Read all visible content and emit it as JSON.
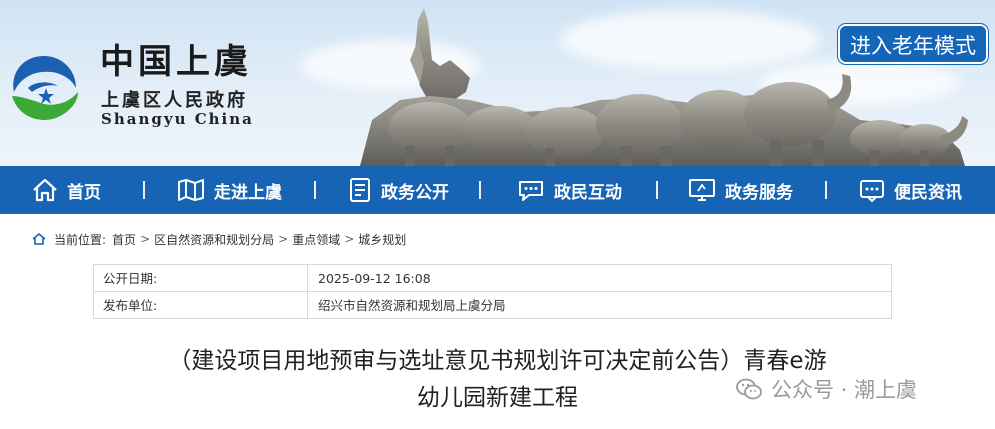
{
  "header": {
    "logo_title": "中国上虞",
    "logo_subtitle": "上虞区人民政府",
    "logo_english": "Shangyu  China",
    "elder_mode_label": "进入老年模式"
  },
  "nav": {
    "items": [
      {
        "label": "首页",
        "icon": "home-icon"
      },
      {
        "label": "走进上虞",
        "icon": "map-icon"
      },
      {
        "label": "政务公开",
        "icon": "document-icon"
      },
      {
        "label": "政民互动",
        "icon": "chat-icon"
      },
      {
        "label": "政务服务",
        "icon": "monitor-icon"
      },
      {
        "label": "便民资讯",
        "icon": "info-message-icon"
      }
    ]
  },
  "breadcrumb": {
    "prefix": "当前位置:",
    "items": [
      "首页",
      "区自然资源和规划分局",
      "重点领域",
      "城乡规划"
    ],
    "separator": ">"
  },
  "info": {
    "rows": [
      {
        "key": "公开日期:",
        "value": "2025-09-12 16:08"
      },
      {
        "key": "发布单位:",
        "value": "绍兴市自然资源和规划局上虞分局"
      }
    ]
  },
  "article": {
    "title_line1": "（建设项目用地预审与选址意见书规划许可决定前公告）青春e游",
    "title_line2": "幼儿园新建工程"
  },
  "watermark": {
    "text": "公众号 · 潮上虞"
  },
  "colors": {
    "nav_bg": "#1764b5",
    "elder_btn_bg": "#1565b8",
    "logo_blue": "#1d5fb0",
    "logo_green": "#3aa935"
  }
}
